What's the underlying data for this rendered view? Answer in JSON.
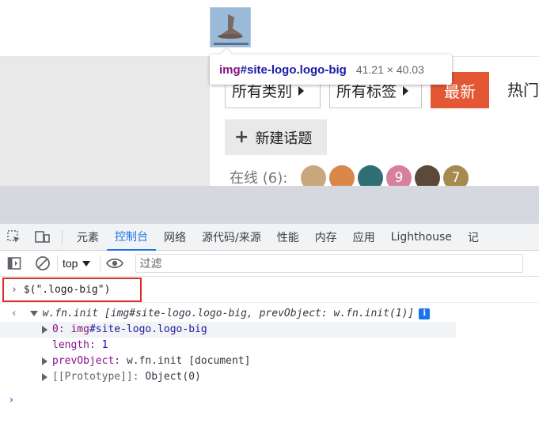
{
  "page": {
    "tooltip": {
      "tag": "img",
      "selector": "#site-logo.logo-big",
      "size": "41.21 × 40.03"
    },
    "filters": {
      "categories_label": "所有类别",
      "tags_label": "所有标签"
    },
    "latest_label": "最新",
    "hot_label": "热门",
    "new_topic_label": "新建话题",
    "online_label": "在线 (6):",
    "avatars": [
      {
        "letter": "",
        "color": "#c9a77c"
      },
      {
        "letter": "",
        "color": "#d9884a"
      },
      {
        "letter": "",
        "color": "#2f6f73"
      },
      {
        "letter": "9",
        "color": "#d77fa1"
      },
      {
        "letter": "",
        "color": "#5b4a3a"
      },
      {
        "letter": "7",
        "color": "#a58b4f"
      }
    ]
  },
  "devtools": {
    "tabs": [
      {
        "label": "元素",
        "active": false
      },
      {
        "label": "控制台",
        "active": true
      },
      {
        "label": "网络",
        "active": false
      },
      {
        "label": "源代码/来源",
        "active": false
      },
      {
        "label": "性能",
        "active": false
      },
      {
        "label": "内存",
        "active": false
      },
      {
        "label": "应用",
        "active": false
      },
      {
        "label": "Lighthouse",
        "active": false
      },
      {
        "label": "记",
        "active": false
      }
    ],
    "context": "top",
    "filter_placeholder": "过滤",
    "console": {
      "command": "$(\".logo-big\")",
      "result_head": "w.fn.init [img#site-logo.logo-big, prevObject: w.fn.init(1)]",
      "rows": {
        "item0_key": "0",
        "item0_tag": "img",
        "item0_sel": "#site-logo.logo-big",
        "length_key": "length",
        "length_val": "1",
        "prev_key": "prevObject",
        "prev_val": "w.fn.init [document]",
        "proto_key": "[[Prototype]]",
        "proto_val": "Object(0)"
      }
    }
  }
}
